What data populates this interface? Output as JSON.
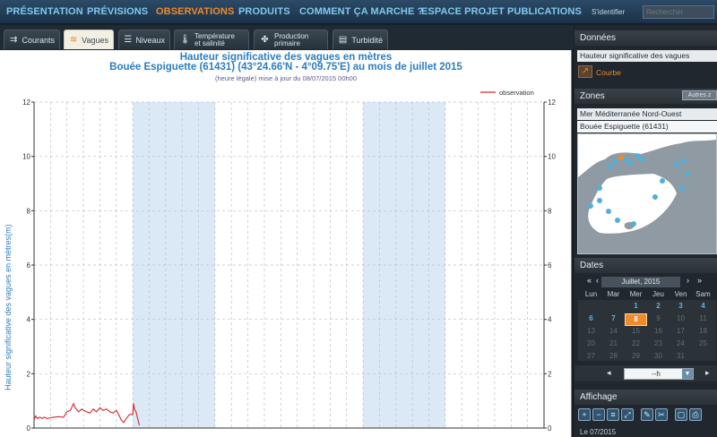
{
  "nav": {
    "items": [
      "PRÉSENTATION",
      "PRÉVISIONS",
      "OBSERVATIONS",
      "PRODUITS",
      "COMMENT ÇA MARCHE ?",
      "ESPACE PROJET",
      "PUBLICATIONS"
    ],
    "active": "OBSERVATIONS",
    "login": "S'identifier",
    "search_placeholder": "Rechercher"
  },
  "tabs": {
    "courants": "Courants",
    "vagues": "Vagues",
    "niveaux": "Niveaux",
    "temperature_1": "Température",
    "temperature_2": "et salinité",
    "production_1": "Production",
    "production_2": "primaire",
    "turbidite": "Turbidité"
  },
  "chart": {
    "title_line1": "Hauteur significative des vagues en mètres",
    "title_line2": "Bouée Espiguette (61431) (43°24.66'N - 4°09.75'E) au mois de juillet 2015",
    "subtitle": "(heure légale) mise à jour du 08/07/2015 00h00",
    "legend": "observation",
    "ylabel": "Hauteur significative des vagues en mètres(m)"
  },
  "chart_data": {
    "type": "line",
    "ylim": [
      0,
      12
    ],
    "y_ticks": [
      0,
      2,
      4,
      6,
      8,
      10,
      12
    ],
    "grid": true,
    "legend_position": "top-right",
    "series": [
      {
        "name": "observation",
        "color": "#d8272e",
        "x": [
          1.0,
          1.1,
          1.2,
          1.35,
          1.5,
          1.6,
          1.8,
          2.0,
          2.2,
          2.5,
          2.8,
          3.0,
          3.2,
          3.4,
          3.5,
          3.7,
          3.9,
          4.0,
          4.2,
          4.4,
          4.6,
          4.8,
          5.0,
          5.2,
          5.4,
          5.6,
          5.8,
          6.0,
          6.1,
          6.3,
          6.45,
          6.6,
          6.8,
          7.0,
          7.05,
          7.1,
          7.2,
          7.3,
          7.4
        ],
        "values": [
          0.3,
          0.45,
          0.35,
          0.4,
          0.35,
          0.4,
          0.35,
          0.38,
          0.4,
          0.42,
          0.4,
          0.6,
          0.65,
          0.9,
          0.75,
          0.6,
          0.7,
          0.65,
          0.6,
          0.55,
          0.7,
          0.6,
          0.75,
          0.65,
          0.7,
          0.6,
          0.55,
          0.65,
          0.55,
          0.3,
          0.2,
          0.35,
          0.5,
          0.5,
          0.9,
          0.7,
          0.6,
          0.35,
          0.1
        ]
      }
    ]
  },
  "sidebar": {
    "donnees_title": "Données",
    "donnees_value": "Hauteur significative des vagues",
    "courbe": "Courbe",
    "zones_title": "Zones",
    "autres_button": "Autres z",
    "zone_value": "Mer Méditerranée Nord-Ouest",
    "bouee_value": "Bouée Espiguette (61431)",
    "dates_title": "Dates",
    "month_label": "Juillet, 2015",
    "prev_label": "«",
    "prev_small": "‹",
    "next_small": "›",
    "next_label": "»",
    "dow": [
      "Lun",
      "Mar",
      "Mer",
      "Jeu",
      "Ven",
      "Sam"
    ],
    "weeks": [
      [
        "",
        "",
        "1",
        "2",
        "3",
        "4"
      ],
      [
        "6",
        "7",
        "8",
        "9",
        "10",
        "11"
      ],
      [
        "13",
        "14",
        "15",
        "16",
        "17",
        "18"
      ],
      [
        "20",
        "21",
        "22",
        "23",
        "24",
        "25"
      ],
      [
        "27",
        "28",
        "29",
        "30",
        "31",
        ""
      ]
    ],
    "time_prev": "◂",
    "time_next": "▸",
    "time_value": "--h",
    "affichage_title": "Affichage",
    "affichage_date": "Le 07/2015"
  },
  "colors": {
    "nav_text": "#7fc9ef",
    "nav_active": "#f08a2a",
    "series_line": "#d8272e",
    "band_fill": "#dbe8f6",
    "today": "#f08a2a"
  }
}
